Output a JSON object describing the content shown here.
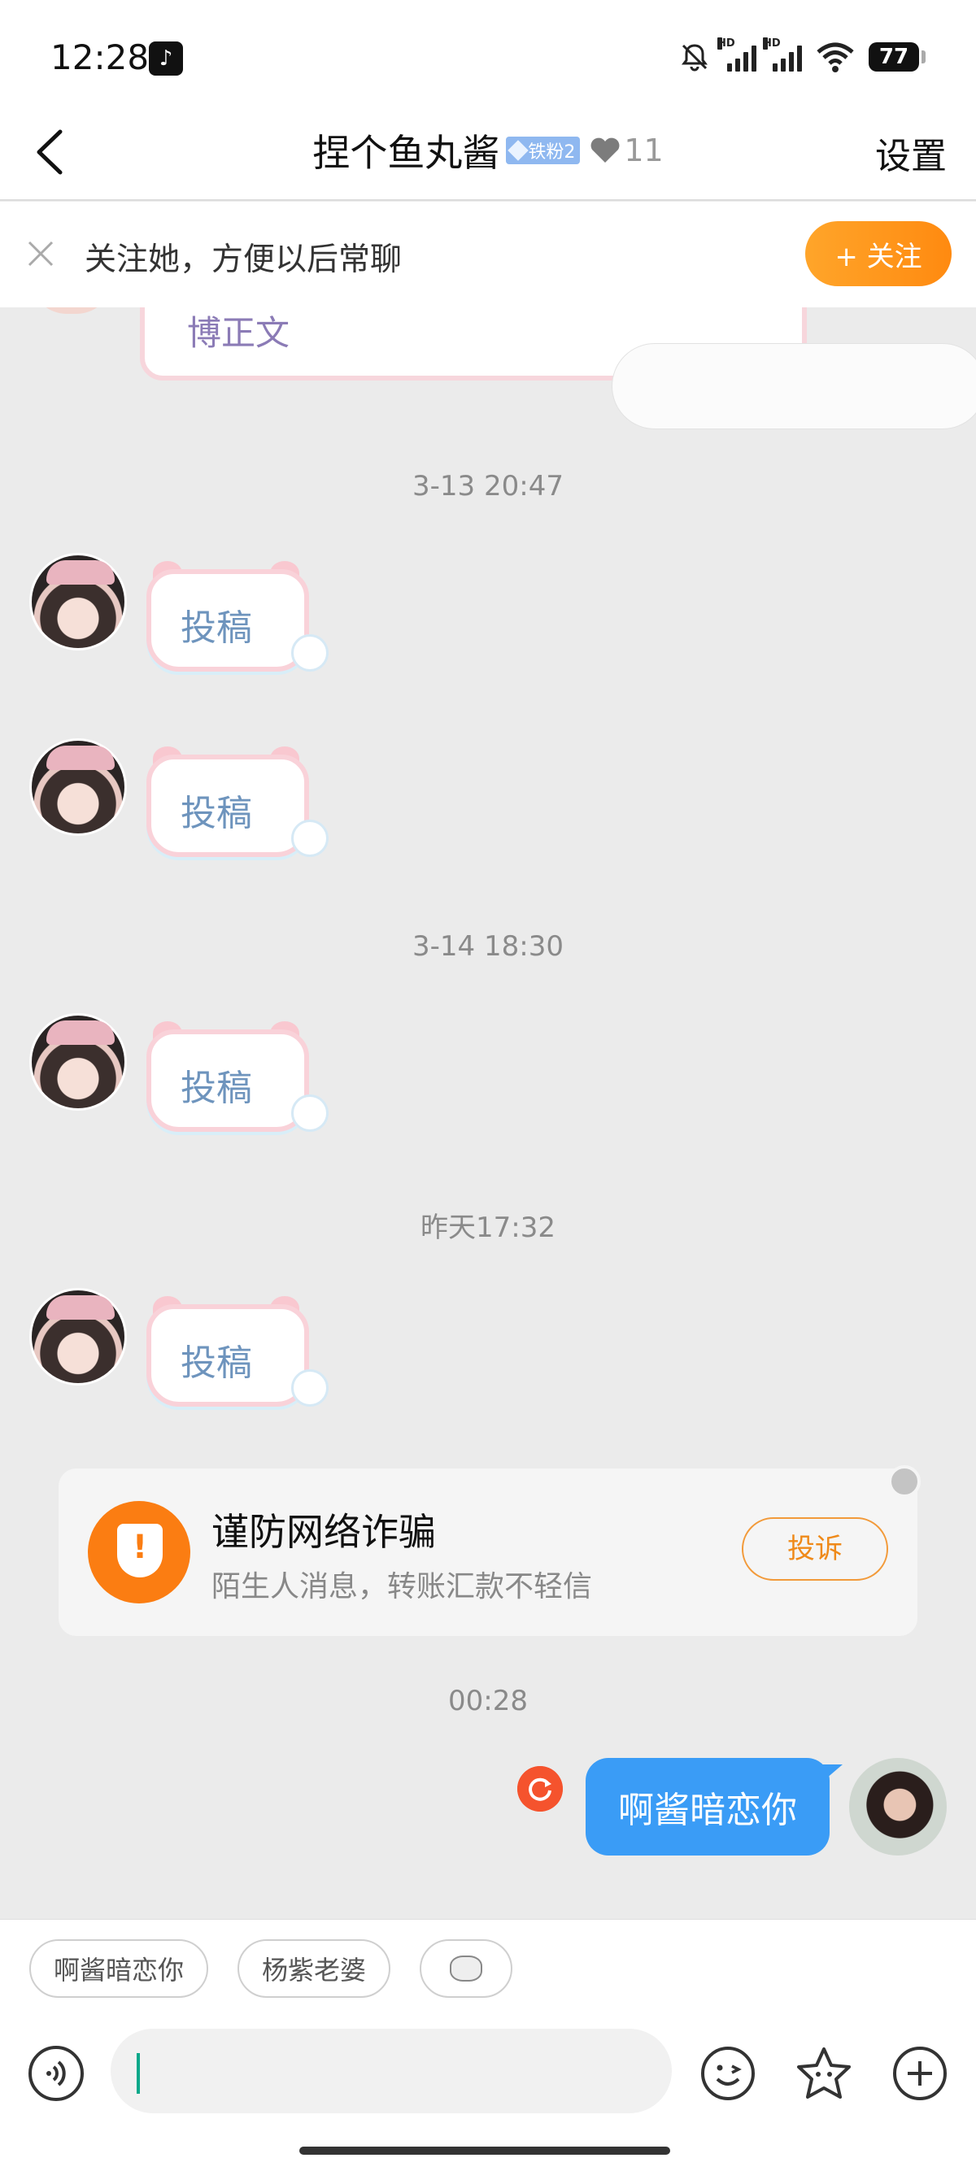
{
  "status_bar": {
    "time": "12:28",
    "app_icon": "tiktok-icon",
    "battery": "77",
    "signal_label": "HD"
  },
  "header": {
    "title": "捏个鱼丸酱",
    "fan_badge": "铁粉2",
    "heart_level": "11",
    "settings": "设置"
  },
  "follow_banner": {
    "text": "关注她，方便以后常聊",
    "button": "+ 关注"
  },
  "chat": {
    "partial_message": "博正文",
    "timestamps": [
      "3-13 20:47",
      "3-14 18:30",
      "昨天17:32",
      "00:28"
    ],
    "sticker_text": "投稿",
    "warning": {
      "title": "谨防网络诈骗",
      "subtitle": "陌生人消息，转账汇款不轻信",
      "report": "投诉"
    },
    "my_message": "啊酱暗恋你"
  },
  "quick_replies": [
    "啊酱暗恋你",
    "杨紫老婆"
  ],
  "input": {
    "value": "",
    "placeholder": ""
  },
  "colors": {
    "accent_orange": "#ff8a10",
    "bubble_blue": "#3a9cf6",
    "warning_orange": "#fb7d12"
  }
}
